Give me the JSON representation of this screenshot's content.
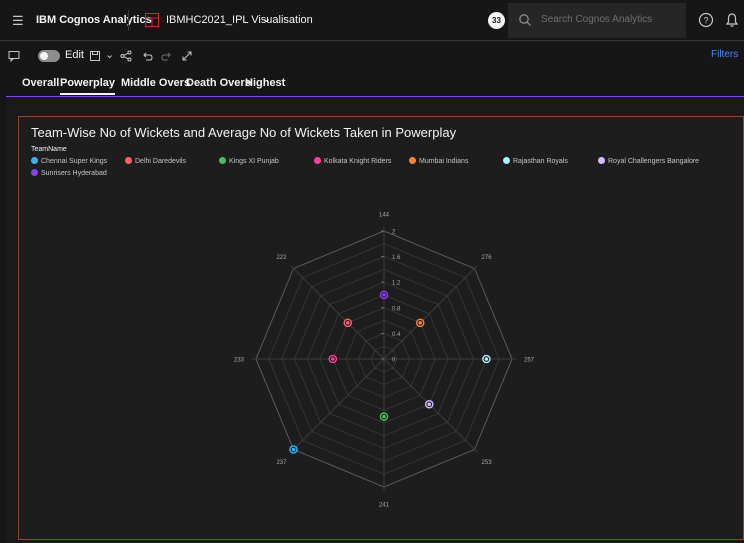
{
  "topbar": {
    "brand": "IBM Cognos Analytics",
    "document_title": "IBMHC2021_IPL Visualisation",
    "badge": "33",
    "search_placeholder": "Search Cognos Analytics"
  },
  "toolbar": {
    "edit_label": "Edit",
    "filters_label": "Filters"
  },
  "tabs": [
    {
      "label": "Overall"
    },
    {
      "label": "Powerplay"
    },
    {
      "label": "Middle Overs"
    },
    {
      "label": "Death Overs"
    },
    {
      "label": "Highest"
    }
  ],
  "chart_data": {
    "type": "radar",
    "title": "Team-Wise No of Wickets and Average No of Wickets Taken in Powerplay",
    "legend_title": "TeamName",
    "axes": [
      "144",
      "276",
      "257",
      "253",
      "241",
      "237",
      "233",
      "222"
    ],
    "radial_ticks": [
      0,
      0.4,
      0.8,
      1.2,
      1.6,
      2
    ],
    "rmax": 2,
    "series": [
      {
        "name": "Chennai Super Kings",
        "color": "#33b1ff",
        "axis": 5,
        "value": 2
      },
      {
        "name": "Delhi Daredevils",
        "color": "#ff5e6d",
        "axis": 7,
        "value": 0.8
      },
      {
        "name": "Kings XI Punjab",
        "color": "#42be65",
        "axis": 4,
        "value": 0.9
      },
      {
        "name": "Kolkata Knight Riders",
        "color": "#ff3ca0",
        "axis": 6,
        "value": 0.8
      },
      {
        "name": "Mumbai Indians",
        "color": "#ff832b",
        "axis": 1,
        "value": 0.8
      },
      {
        "name": "Rajasthan Royals",
        "color": "#a6f0ff",
        "axis": 2,
        "value": 1.6
      },
      {
        "name": "Royal Challengers Bangalore",
        "color": "#d4bbff",
        "axis": 3,
        "value": 1.0
      },
      {
        "name": "Sunrisers Hyderabad",
        "color": "#8a3ffc",
        "axis": 0,
        "value": 1.0
      }
    ]
  }
}
